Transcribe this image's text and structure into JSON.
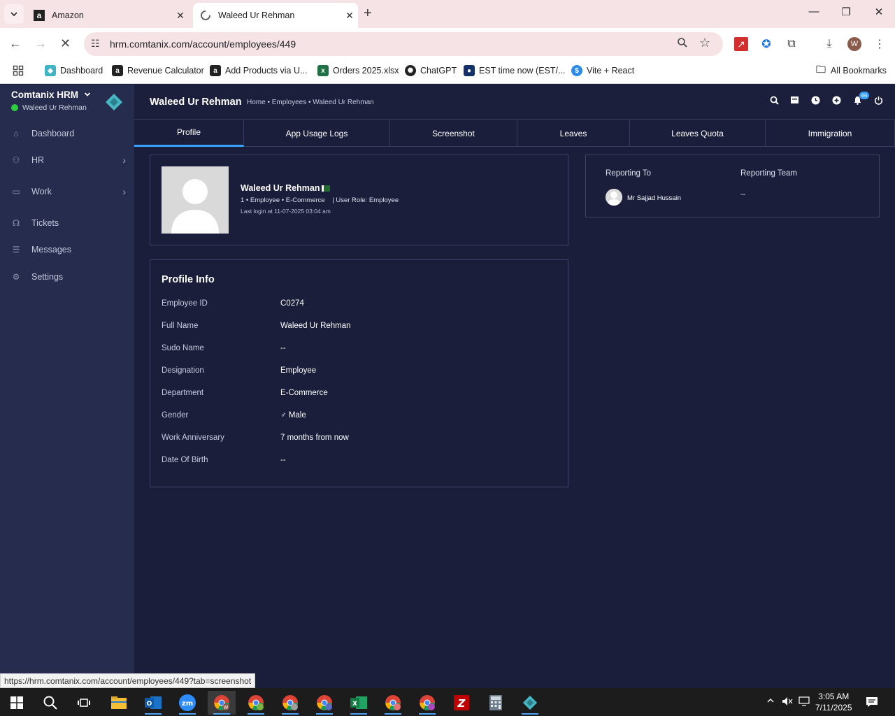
{
  "browser": {
    "tabs": [
      {
        "title": "Amazon",
        "close": "✕"
      },
      {
        "title": "Waleed Ur Rehman",
        "close": "✕"
      }
    ],
    "new_tab": "+",
    "window_controls": {
      "minimize": "—",
      "restore": "❐",
      "close": "✕"
    },
    "url": "hrm.comtanix.com/account/employees/449",
    "profile_initial": "W",
    "bookmarks": [
      {
        "label": "Dashboard"
      },
      {
        "label": "Revenue Calculator"
      },
      {
        "label": "Add Products via U..."
      },
      {
        "label": "Orders 2025.xlsx"
      },
      {
        "label": "ChatGPT"
      },
      {
        "label": "EST time now (EST/..."
      },
      {
        "label": "Vite + React"
      }
    ],
    "all_bookmarks": "All Bookmarks",
    "status_url": "https://hrm.comtanix.com/account/employees/449?tab=screenshot"
  },
  "sidebar": {
    "brand": "Comtanix HRM",
    "brand_chevron": "⌄",
    "user": "Waleed Ur Rehman",
    "items": [
      {
        "label": "Dashboard",
        "icon": "home-icon"
      },
      {
        "label": "HR",
        "icon": "users-icon",
        "chevron": "›"
      },
      {
        "label": "Work",
        "icon": "briefcase-icon",
        "chevron": "›"
      },
      {
        "label": "Tickets",
        "icon": "headset-icon"
      },
      {
        "label": "Messages",
        "icon": "chat-icon"
      },
      {
        "label": "Settings",
        "icon": "gear-icon"
      }
    ]
  },
  "topbar": {
    "title": "Waleed Ur Rehman",
    "breadcrumb": "Home • Employees • Waleed Ur Rehman",
    "notification_count": "66"
  },
  "tabs": [
    "Profile",
    "App Usage Logs",
    "Screenshot",
    "Leaves",
    "Leaves Quota",
    "Immigration"
  ],
  "active_tab": "Profile",
  "employee": {
    "name": "Waleed Ur Rehman",
    "meta": "1 • Employee • E-Commerce    | User Role: Employee",
    "last_login": "Last login at 11-07-2025 03:04 am"
  },
  "reporting": {
    "to_label": "Reporting To",
    "team_label": "Reporting Team",
    "manager": "Mr Sajjad Hussain",
    "team_value": "--"
  },
  "profile_info": {
    "title": "Profile Info",
    "rows": [
      {
        "label": "Employee ID",
        "value": "C0274"
      },
      {
        "label": "Full Name",
        "value": "Waleed Ur Rehman"
      },
      {
        "label": "Sudo Name",
        "value": "--"
      },
      {
        "label": "Designation",
        "value": "Employee"
      },
      {
        "label": "Department",
        "value": "E-Commerce"
      },
      {
        "label": "Gender",
        "value": "♂ Male"
      },
      {
        "label": "Work Anniversary",
        "value": "7 months from now"
      },
      {
        "label": "Date Of Birth",
        "value": "--"
      }
    ]
  },
  "taskbar": {
    "time": "3:05 AM",
    "date": "7/11/2025"
  },
  "colors": {
    "sidebar": "#262c4e",
    "content_bg": "#1a1e3a",
    "accent": "#3aa0ff",
    "online": "#2ecc40"
  }
}
